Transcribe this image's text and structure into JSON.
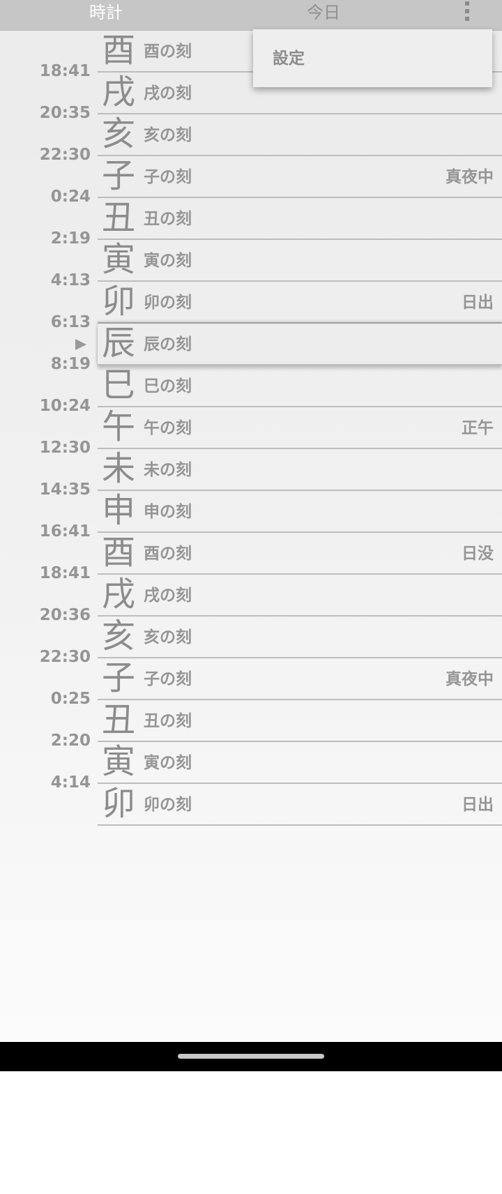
{
  "tabs": {
    "clock": "時計",
    "today": "今日"
  },
  "menu": {
    "icon": "more-vert-icon",
    "items": [
      {
        "label": "設定"
      }
    ]
  },
  "current_index": 7,
  "rows": [
    {
      "kanji": "酉",
      "name": "酉の刻",
      "note": ""
    },
    {
      "kanji": "戌",
      "name": "戌の刻",
      "note": ""
    },
    {
      "kanji": "亥",
      "name": "亥の刻",
      "note": ""
    },
    {
      "kanji": "子",
      "name": "子の刻",
      "note": "真夜中"
    },
    {
      "kanji": "丑",
      "name": "丑の刻",
      "note": ""
    },
    {
      "kanji": "寅",
      "name": "寅の刻",
      "note": ""
    },
    {
      "kanji": "卯",
      "name": "卯の刻",
      "note": "日出"
    },
    {
      "kanji": "辰",
      "name": "辰の刻",
      "note": ""
    },
    {
      "kanji": "巳",
      "name": "巳の刻",
      "note": ""
    },
    {
      "kanji": "午",
      "name": "午の刻",
      "note": "正午"
    },
    {
      "kanji": "未",
      "name": "未の刻",
      "note": ""
    },
    {
      "kanji": "申",
      "name": "申の刻",
      "note": ""
    },
    {
      "kanji": "酉",
      "name": "酉の刻",
      "note": "日没"
    },
    {
      "kanji": "戌",
      "name": "戌の刻",
      "note": ""
    },
    {
      "kanji": "亥",
      "name": "亥の刻",
      "note": ""
    },
    {
      "kanji": "子",
      "name": "子の刻",
      "note": "真夜中"
    },
    {
      "kanji": "丑",
      "name": "丑の刻",
      "note": ""
    },
    {
      "kanji": "寅",
      "name": "寅の刻",
      "note": ""
    },
    {
      "kanji": "卯",
      "name": "卯の刻",
      "note": "日出"
    }
  ],
  "times": [
    "18:41",
    "20:35",
    "22:30",
    "0:24",
    "2:19",
    "4:13",
    "6:13",
    "8:19",
    "10:24",
    "12:30",
    "14:35",
    "16:41",
    "18:41",
    "20:36",
    "22:30",
    "0:25",
    "2:20",
    "4:14"
  ],
  "colors": {
    "topbar": "#c6c6c6",
    "text": "#959595",
    "separator": "#bdbdbd",
    "navbar": "#000000"
  }
}
